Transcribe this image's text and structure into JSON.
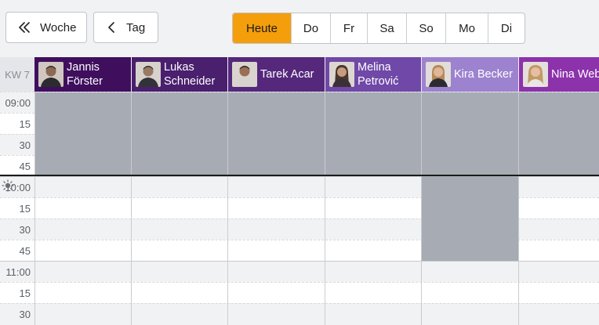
{
  "toolbar": {
    "week_label": "Woche",
    "day_label": "Tag",
    "segments": [
      {
        "label": "Heute",
        "active": true
      },
      {
        "label": "Do"
      },
      {
        "label": "Fr"
      },
      {
        "label": "Sa"
      },
      {
        "label": "So"
      },
      {
        "label": "Mo"
      },
      {
        "label": "Di"
      }
    ]
  },
  "calendar": {
    "week_label": "KW 7",
    "staff": [
      {
        "first": "Jannis",
        "last": "Förster",
        "color": "#3f0f5e"
      },
      {
        "first": "Lukas",
        "last": "Schneider",
        "color": "#4a1f6e"
      },
      {
        "first": "Tarek Acar",
        "last": "",
        "color": "#55287c"
      },
      {
        "first": "Melina",
        "last": "Petrović",
        "color": "#7048a7"
      },
      {
        "first": "Kira Becker",
        "last": "",
        "color": "#9d82cf"
      },
      {
        "first": "Nina Weber",
        "last": "",
        "color": "#8c32ab"
      }
    ],
    "times": [
      "09:00",
      "15",
      "30",
      "45",
      "10:00",
      "15",
      "30",
      "45",
      "11:00",
      "15",
      "30"
    ],
    "colors": {
      "accent": "#f59e0b",
      "unavailable": "#a6abb4",
      "now_line": "#1b1b1b"
    }
  }
}
